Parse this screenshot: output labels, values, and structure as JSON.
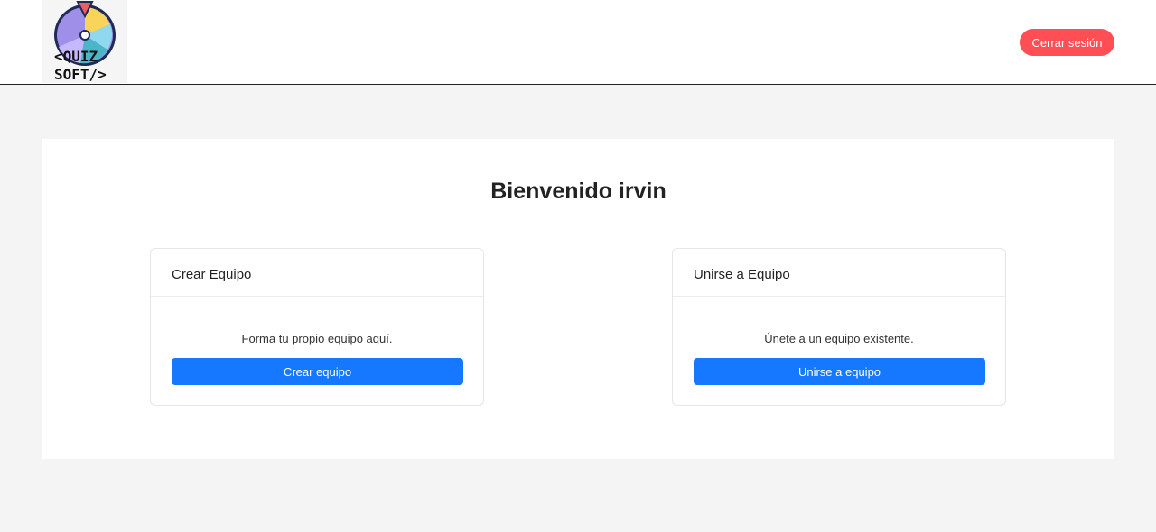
{
  "header": {
    "logo": {
      "line1": "<QUIZ",
      "line2": "SOFT/>"
    },
    "logout_label": "Cerrar sesión"
  },
  "main": {
    "welcome": "Bienvenido irvin",
    "cards": [
      {
        "title": "Crear Equipo",
        "text": "Forma tu propio equipo aquí.",
        "button": "Crear equipo"
      },
      {
        "title": "Unirse a Equipo",
        "text": "Únete a un equipo existente.",
        "button": "Unirse a equipo"
      }
    ]
  },
  "colors": {
    "logout": "#ff4f55",
    "primary": "#1677ff",
    "background": "#f4f4f4"
  }
}
